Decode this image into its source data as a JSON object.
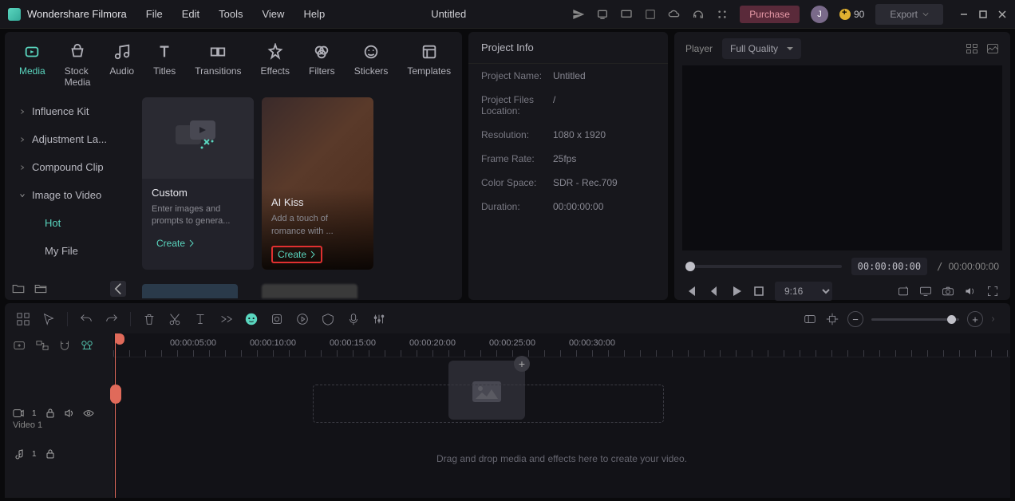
{
  "app": {
    "title": "Wondershare Filmora",
    "doc_title": "Untitled"
  },
  "menu": [
    "File",
    "Edit",
    "Tools",
    "View",
    "Help"
  ],
  "header": {
    "purchase": "Purchase",
    "avatar_initial": "J",
    "coins": "90",
    "export": "Export"
  },
  "tabs": [
    {
      "label": "Media",
      "active": true
    },
    {
      "label": "Stock Media"
    },
    {
      "label": "Audio"
    },
    {
      "label": "Titles"
    },
    {
      "label": "Transitions"
    },
    {
      "label": "Effects"
    },
    {
      "label": "Filters"
    },
    {
      "label": "Stickers"
    },
    {
      "label": "Templates"
    }
  ],
  "sidebar": {
    "items": [
      {
        "label": "Influence Kit"
      },
      {
        "label": "Adjustment La..."
      },
      {
        "label": "Compound Clip"
      },
      {
        "label": "Image to Video",
        "open": true
      }
    ],
    "subs": [
      {
        "label": "Hot",
        "active": true
      },
      {
        "label": "My File"
      }
    ]
  },
  "cards": [
    {
      "title": "Custom",
      "desc": "Enter images and prompts to genera...",
      "cta": "Create"
    },
    {
      "title": "AI Kiss",
      "desc": "Add a touch of romance with ...",
      "cta": "Create",
      "highlight": true
    }
  ],
  "project_info": {
    "title": "Project Info",
    "rows": [
      {
        "label": "Project Name:",
        "value": "Untitled"
      },
      {
        "label": "Project Files Location:",
        "value": "/"
      },
      {
        "label": "Resolution:",
        "value": "1080 x 1920"
      },
      {
        "label": "Frame Rate:",
        "value": "25fps"
      },
      {
        "label": "Color Space:",
        "value": "SDR - Rec.709"
      },
      {
        "label": "Duration:",
        "value": "00:00:00:00"
      }
    ]
  },
  "player": {
    "label": "Player",
    "quality": "Full Quality",
    "current_time": "00:00:00:00",
    "total_time": "00:00:00:00",
    "duration_select": "9:16"
  },
  "timeline": {
    "ticks": [
      "00:00:05:00",
      "00:00:10:00",
      "00:00:15:00",
      "00:00:20:00",
      "00:00:25:00",
      "00:00:30:00"
    ],
    "tick_positions": [
      100,
      200,
      300,
      400,
      500,
      600
    ],
    "drop_text": "Drag and drop media and effects here to create your video.",
    "tracks": [
      {
        "label": "Video 1",
        "type": "video",
        "count": "1"
      }
    ]
  }
}
